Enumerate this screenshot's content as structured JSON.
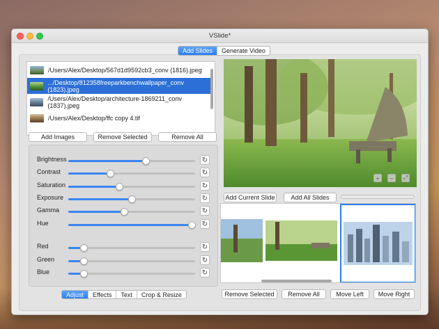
{
  "window": {
    "title": "VSlide*"
  },
  "top_tabs": [
    {
      "label": "Add Slides",
      "active": true
    },
    {
      "label": "Generate Video",
      "active": false
    }
  ],
  "files": [
    {
      "path": "/Users/Alex/Desktop/567d1d9592cb3_conv (1816).jpeg",
      "selected": false
    },
    {
      "path": ".../Desktop/812358freeparkbenchwallpaper_conv (1823).jpeg",
      "selected": true
    },
    {
      "path": "/Users/Alex/Desktop/architecture-1869211_conv (1837).jpeg",
      "selected": false
    },
    {
      "path": "/Users/Alex/Desktop/ffc copy 4.tif",
      "selected": false
    }
  ],
  "file_buttons": {
    "add": "Add Images",
    "remove_selected": "Remove Selected",
    "remove_all": "Remove All"
  },
  "sliders": [
    {
      "label": "Brightness",
      "value": 0.61
    },
    {
      "label": "Contrast",
      "value": 0.33
    },
    {
      "label": "Saturation",
      "value": 0.4
    },
    {
      "label": "Exposure",
      "value": 0.5
    },
    {
      "label": "Gamma",
      "value": 0.44
    },
    {
      "label": "Hue",
      "value": 0.97
    },
    {
      "label": "Red",
      "value": 0.12
    },
    {
      "label": "Green",
      "value": 0.12
    },
    {
      "label": "Blue",
      "value": 0.12
    }
  ],
  "reset_icon": "↻",
  "bottom_tabs": [
    {
      "label": "Adjust",
      "active": true
    },
    {
      "label": "Effects",
      "active": false
    },
    {
      "label": "Text",
      "active": false
    },
    {
      "label": "Crop & Resize",
      "active": false
    }
  ],
  "slide_buttons": {
    "add_current": "Add Current Slide",
    "add_all": "Add All Slides"
  },
  "progress": 0,
  "preview_controls": [
    "+",
    "–",
    "⤢"
  ],
  "filmstrip_buttons": {
    "remove_selected": "Remove Selected",
    "remove_all": "Remove All",
    "move_left": "Move Left",
    "move_right": "Move Right"
  },
  "colors": {
    "accent": "#2c7ef2",
    "selection": "#2c6fd6"
  }
}
